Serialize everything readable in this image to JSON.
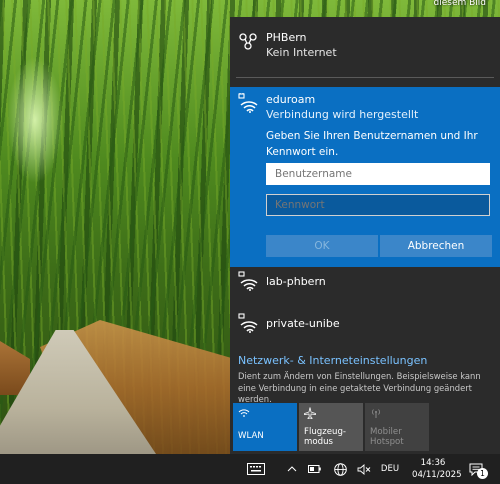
{
  "wallpaper": {
    "corner_caption": "diesem Bild"
  },
  "networks": [
    {
      "name": "PHBern",
      "status": "Kein Internet"
    },
    {
      "name": "eduroam",
      "status": "Verbindung wird hergestellt"
    },
    {
      "name": "lab-phbern"
    },
    {
      "name": "private-unibe"
    }
  ],
  "login": {
    "prompt": "Geben Sie Ihren Benutzernamen und Ihr Kennwort ein.",
    "username_placeholder": "Benutzername",
    "password_placeholder": "Kennwort",
    "ok_label": "OK",
    "cancel_label": "Abbrechen"
  },
  "settings": {
    "title": "Netzwerk- & Interneteinstellungen",
    "description": "Dient zum Ändern von Einstellungen. Beispielsweise kann eine Verbindung in eine getaktete Verbindung geändert werden."
  },
  "quick_actions": {
    "wlan": "WLAN",
    "flight_line1": "Flugzeug-",
    "flight_line2": "modus",
    "hotspot_line1": "Mobiler",
    "hotspot_line2": "Hotspot"
  },
  "taskbar": {
    "language": "DEU",
    "time": "14:36",
    "date": "04/11/2025",
    "notification_count": "1"
  },
  "colors": {
    "accent": "#0a6fc2",
    "flyout_bg": "#2b2b2b",
    "link": "#7ac2ff",
    "taskbar": "#202020"
  },
  "icons": [
    "ethernet-network-icon",
    "wifi-secured-icon",
    "wifi-icon",
    "airplane-icon",
    "hotspot-icon",
    "keyboard-icon",
    "chevron-up-icon",
    "battery-icon",
    "globe-icon",
    "volume-muted-icon",
    "notification-icon"
  ]
}
